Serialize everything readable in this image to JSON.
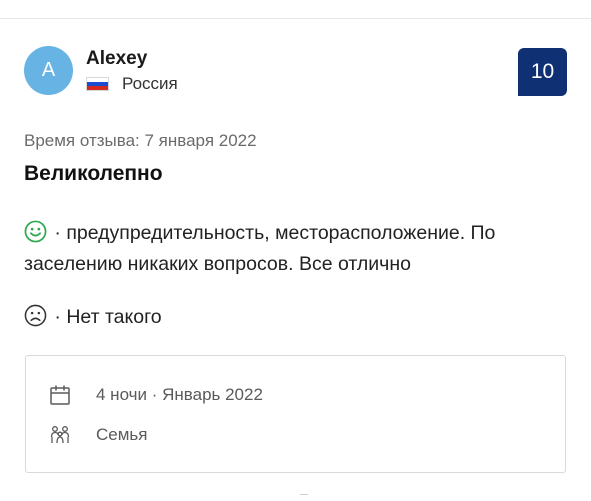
{
  "reviewer": {
    "avatar_letter": "A",
    "name": "Alexey",
    "country": "Россия",
    "flag_colors": [
      "#ffffff",
      "#1c4bd1",
      "#d52b1e"
    ]
  },
  "score": "10",
  "review_date": "Время отзыва: 7 января 2022",
  "review_title": "Великолепно",
  "positive": {
    "icon": "smile-icon",
    "color": "#2fa84f",
    "text": " · предупредительность, месторасположение. По заселению никаких вопросов. Все отлично"
  },
  "negative": {
    "icon": "frown-icon",
    "text": " · Нет такого"
  },
  "stay": {
    "nights": "4 ночи · Январь 2022",
    "traveler_type": "Семья"
  },
  "colors": {
    "score_bg": "#0f3072",
    "avatar_bg": "#67b4e4"
  }
}
